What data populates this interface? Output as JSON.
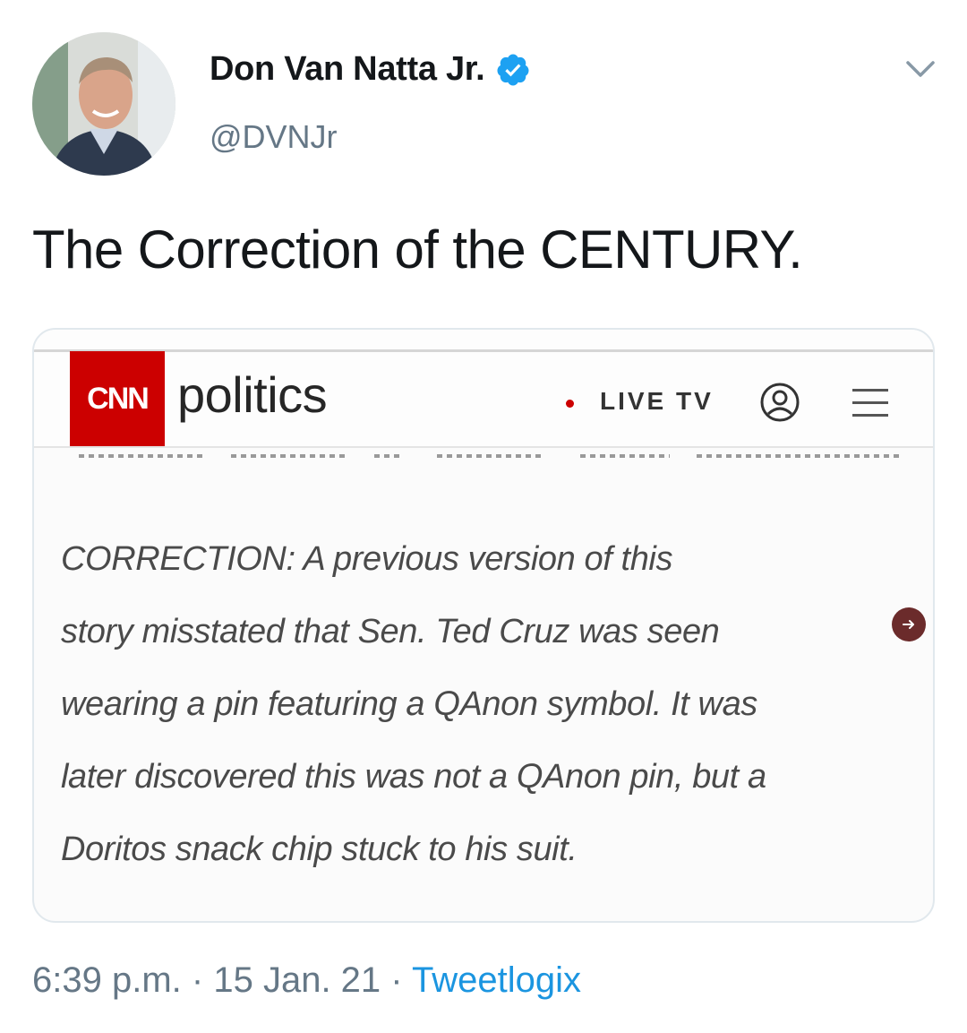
{
  "author": {
    "display_name": "Don Van Natta Jr.",
    "handle": "@DVNJr",
    "verified": true,
    "avatar_icon": "person-photo"
  },
  "tweet": {
    "text": "The Correction of the CENTURY."
  },
  "media": {
    "cnn_logo": "CNN",
    "section": "politics",
    "live_label": "LIVE TV",
    "icons": [
      "user-icon",
      "menu-icon",
      "arrow-right-icon"
    ],
    "correction_lines": [
      "CORRECTION: A previous version of this",
      "story misstated that Sen. Ted Cruz was seen",
      "wearing a pin featuring a QAnon symbol. It was",
      "later discovered this was not a QAnon pin, but a",
      "Doritos snack chip stuck to his suit."
    ]
  },
  "footer": {
    "time": "6:39 p.m.",
    "date": "15 Jan. 21",
    "separator": "·",
    "source": "Tweetlogix"
  },
  "colors": {
    "verified_blue": "#1da1f2",
    "link_blue": "#1b95e0",
    "cnn_red": "#cc0000",
    "meta_gray": "#657786"
  }
}
